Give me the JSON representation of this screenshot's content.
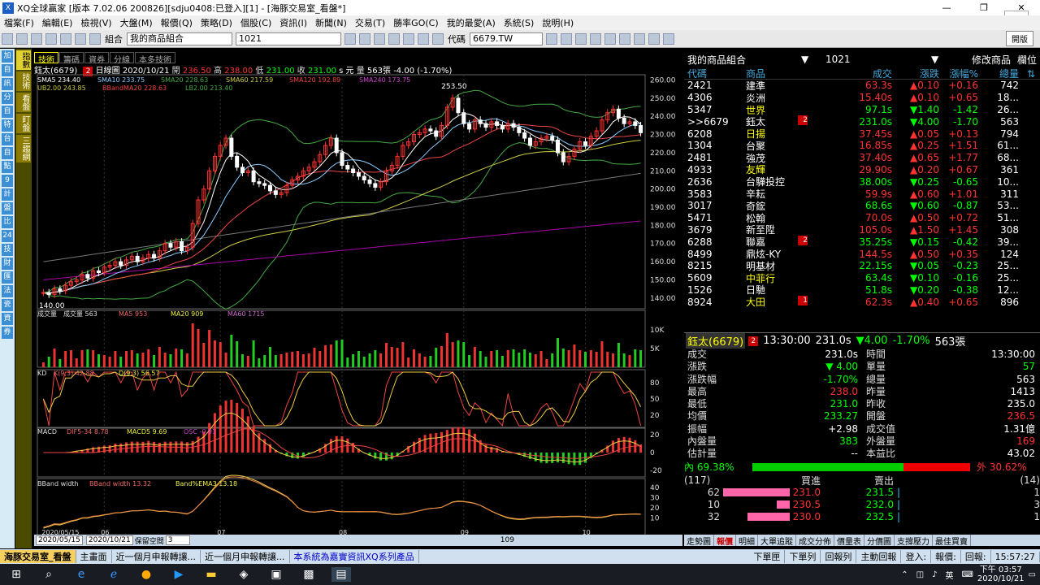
{
  "window": {
    "title": "XQ全球贏家 [版本 7.02.06 200826][sdju0408:已登入][1] - [海豚交易室_看盤*]",
    "min": "—",
    "max": "❐",
    "close": "✕"
  },
  "menu": [
    "檔案(F)",
    "編輯(E)",
    "檢視(V)",
    "大盤(M)",
    "報價(Q)",
    "策略(D)",
    "個股(C)",
    "資訊(I)",
    "新聞(N)",
    "交易(T)",
    "勝率GO(C)",
    "我的最愛(A)",
    "系統(S)",
    "說明(H)"
  ],
  "toolbar": {
    "group_label": "組合",
    "group_value": "我的商品組合",
    "list_value": "1021",
    "code_label": "代碼",
    "code_value": "6679.TW",
    "right_button": "開版"
  },
  "left_sidebar": [
    "加",
    "自",
    "訊",
    "分",
    "自",
    "特",
    "台",
    "自",
    "點",
    "9",
    "計",
    "盤",
    "比",
    "24",
    "技",
    "財",
    "匯",
    "法",
    "瓷",
    "資",
    "券"
  ],
  "vertical_tabs": [
    {
      "label": "指數",
      "active": true
    },
    {
      "label": "技術",
      "active": false
    },
    {
      "label": "看盤",
      "active": false
    },
    {
      "label": "盯盤",
      "active": false
    },
    {
      "label": "三趨網",
      "active": false
    }
  ],
  "chart_tabs": [
    {
      "label": "技術",
      "active": true
    },
    {
      "label": "籌碼",
      "active": false
    },
    {
      "label": "資券",
      "active": false
    },
    {
      "label": "分線",
      "active": false
    },
    {
      "label": "本多技術",
      "active": false
    }
  ],
  "stock_info": {
    "name": "鈺太(6679)",
    "badge": "2",
    "period": "日線圖",
    "date": "2020/10/21",
    "open_l": "開",
    "open": "236.50",
    "high_l": "高",
    "high": "238.00",
    "low_l": "低",
    "low": "231.00",
    "close_l": "收",
    "close": "231.00",
    "unit": "s 元",
    "vol_l": "量",
    "vol": "563張",
    "chg": "-4.00 (-1.70%)"
  },
  "chart_data": {
    "type": "line",
    "price": {
      "dates": [
        "05/15",
        "05/18",
        "05/19",
        "05/20",
        "05/21",
        "05/22",
        "05/25",
        "05/26",
        "05/27",
        "05/28",
        "05/29",
        "06/01",
        "06/02",
        "06/03",
        "06/04",
        "06/05",
        "06/08",
        "06/09",
        "06/10",
        "06/11",
        "06/12",
        "06/15",
        "06/16",
        "06/17",
        "06/18",
        "06/19",
        "06/22",
        "06/23",
        "06/24",
        "06/29",
        "06/30",
        "07/01",
        "07/02",
        "07/03",
        "07/06",
        "07/07",
        "07/08",
        "07/09",
        "07/10",
        "07/13",
        "07/14",
        "07/15",
        "07/16",
        "07/17",
        "07/20",
        "07/21",
        "07/22",
        "07/23",
        "07/24",
        "07/27",
        "07/28",
        "07/29",
        "07/30",
        "07/31",
        "08/03",
        "08/04",
        "08/05",
        "08/06",
        "08/07",
        "08/10",
        "08/11",
        "08/12",
        "08/13",
        "08/14",
        "08/17",
        "08/18",
        "08/19",
        "08/20",
        "08/21",
        "08/24",
        "08/25",
        "08/26",
        "08/27",
        "08/28",
        "08/31",
        "09/01",
        "09/02",
        "09/03",
        "09/04",
        "09/07",
        "09/08",
        "09/09",
        "09/10",
        "09/11",
        "09/14",
        "09/15",
        "09/16",
        "09/17",
        "09/18",
        "09/21",
        "09/22",
        "09/23",
        "09/24",
        "09/25",
        "09/28",
        "09/29",
        "09/30",
        "10/05",
        "10/06",
        "10/07",
        "10/08",
        "10/12",
        "10/13",
        "10/14",
        "10/15",
        "10/16",
        "10/19",
        "10/20",
        "10/21"
      ],
      "close": [
        143,
        142,
        145,
        144,
        147,
        149,
        150,
        153,
        151,
        155,
        154,
        157,
        158,
        160,
        158,
        161,
        163,
        160,
        162,
        164,
        162,
        166,
        170,
        168,
        171,
        166,
        168,
        181,
        194,
        200,
        210,
        218,
        224,
        228,
        218,
        212,
        209,
        210,
        204,
        203,
        202,
        199,
        197,
        198,
        202,
        205,
        207,
        210,
        212,
        215,
        219,
        224,
        228,
        220,
        213,
        211,
        209,
        207,
        205,
        203,
        201,
        204,
        210,
        213,
        218,
        224,
        226,
        230,
        231,
        233,
        232,
        229,
        235,
        245,
        250,
        242,
        236,
        233,
        238,
        236,
        234,
        237,
        235,
        233,
        236,
        234,
        231,
        228,
        224,
        226,
        228,
        229,
        227,
        220,
        215,
        218,
        222,
        226,
        224,
        229,
        232,
        238,
        242,
        244,
        239,
        236,
        237,
        235,
        231
      ],
      "ma5_label": "SMA5 234.40",
      "ma10_label": "SMA10 233.75",
      "ma20_label": "SMA20 228.63",
      "ma60_label": "SMA60 217.59",
      "ma120_label": "SMA120 192.89",
      "ma240_label": "SMA240 173.75",
      "ub_label": "UB2.00 243.85",
      "mid_label": "BBandMA20 228.63",
      "lb_label": "LB2.00 213.40",
      "ylim": [
        135,
        262
      ],
      "yticks": [
        260,
        250,
        240,
        230,
        220,
        210,
        200,
        190,
        180,
        170,
        160,
        150,
        140
      ],
      "max_label": "253.50",
      "min_label": "140.00"
    },
    "volume": {
      "title": "成交量",
      "cur": "成交量 563",
      "ma5": "MA5 953",
      "ma20": "MA20 909",
      "ma60": "MA60 1715",
      "yticks": [
        "10K",
        "5K"
      ]
    },
    "kd": {
      "title": "KD",
      "k": "K(9,3) 42.88",
      "d": "D(9,3) 56.57",
      "yticks": [
        80,
        50,
        20
      ]
    },
    "macd": {
      "title": "MACD",
      "dif": "DIF5-34 8.78",
      "macd": "MACD5 9.69",
      "osc": "OSC -0.91",
      "yticks": [
        20,
        0,
        -20
      ]
    },
    "bbw": {
      "title": "BBand width",
      "bw": "BBand width 13.32",
      "ema": "Band%EMA3 13.18",
      "yticks": [
        40,
        30,
        20,
        10
      ]
    },
    "xticks": [
      "2020/05/15",
      "06",
      "07",
      "08",
      "09",
      "10"
    ]
  },
  "chart_bottom": {
    "from": "2020/05/15",
    "to": "2020/10/21",
    "label": "保留空間",
    "space": "3",
    "count": "109"
  },
  "watchlist": {
    "title": "我的商品組合",
    "list": "1021",
    "edit": "修改商品",
    "col": "欄位",
    "headers": [
      "代碼",
      "商品",
      "成交",
      "漲跌",
      "漲幅%",
      "總量"
    ],
    "rows": [
      {
        "code": "2421",
        "name": "建準",
        "price": "63.3s",
        "chg": "▲0.10",
        "pct": "+0.16",
        "vol": "742",
        "nc": "#fff",
        "badge": ""
      },
      {
        "code": "4306",
        "name": "炎洲",
        "price": "15.40s",
        "chg": "▲0.10",
        "pct": "+0.65",
        "vol": "18...",
        "nc": "#fff",
        "badge": ""
      },
      {
        "code": "5347",
        "name": "世界",
        "price": "97.1s",
        "chg": "▼1.40",
        "pct": "-1.42",
        "vol": "26...",
        "nc": "#ff0",
        "badge": ""
      },
      {
        "code": ">>6679",
        "name": "鈺太",
        "price": "231.0s",
        "chg": "▼4.00",
        "pct": "-1.70",
        "vol": "563",
        "nc": "#fff",
        "badge": "2"
      },
      {
        "code": "6208",
        "name": "日揚",
        "price": "37.45s",
        "chg": "▲0.05",
        "pct": "+0.13",
        "vol": "794",
        "nc": "#ff0",
        "badge": ""
      },
      {
        "code": "1304",
        "name": "台聚",
        "price": "16.85s",
        "chg": "▲0.25",
        "pct": "+1.51",
        "vol": "61...",
        "nc": "#fff",
        "badge": ""
      },
      {
        "code": "2481",
        "name": "強茂",
        "price": "37.40s",
        "chg": "▲0.65",
        "pct": "+1.77",
        "vol": "68...",
        "nc": "#fff",
        "badge": ""
      },
      {
        "code": "4933",
        "name": "友輝",
        "price": "29.90s",
        "chg": "▲0.20",
        "pct": "+0.67",
        "vol": "361",
        "nc": "#ff0",
        "badge": ""
      },
      {
        "code": "2636",
        "name": "台驊投控",
        "price": "38.00s",
        "chg": "▼0.25",
        "pct": "-0.65",
        "vol": "10...",
        "nc": "#fff",
        "badge": ""
      },
      {
        "code": "3583",
        "name": "辛耘",
        "price": "59.9s",
        "chg": "▲0.60",
        "pct": "+1.01",
        "vol": "311",
        "nc": "#fff",
        "badge": ""
      },
      {
        "code": "3017",
        "name": "奇鋐",
        "price": "68.6s",
        "chg": "▼0.60",
        "pct": "-0.87",
        "vol": "53...",
        "nc": "#fff",
        "badge": ""
      },
      {
        "code": "5471",
        "name": "松翰",
        "price": "70.0s",
        "chg": "▲0.50",
        "pct": "+0.72",
        "vol": "51...",
        "nc": "#fff",
        "badge": ""
      },
      {
        "code": "3679",
        "name": "新至陞",
        "price": "105.0s",
        "chg": "▲1.50",
        "pct": "+1.45",
        "vol": "308",
        "nc": "#fff",
        "badge": ""
      },
      {
        "code": "6288",
        "name": "聯嘉",
        "price": "35.25s",
        "chg": "▼0.15",
        "pct": "-0.42",
        "vol": "39...",
        "nc": "#fff",
        "badge": "2"
      },
      {
        "code": "8499",
        "name": "鼎炫-KY",
        "price": "144.5s",
        "chg": "▲0.50",
        "pct": "+0.35",
        "vol": "124",
        "nc": "#fff",
        "badge": ""
      },
      {
        "code": "8215",
        "name": "明基材",
        "price": "22.15s",
        "chg": "▼0.05",
        "pct": "-0.23",
        "vol": "25...",
        "nc": "#fff",
        "badge": ""
      },
      {
        "code": "5609",
        "name": "中菲行",
        "price": "63.4s",
        "chg": "▼0.10",
        "pct": "-0.16",
        "vol": "25...",
        "nc": "#ff0",
        "badge": ""
      },
      {
        "code": "1526",
        "name": "日馳",
        "price": "51.8s",
        "chg": "▼0.20",
        "pct": "-0.38",
        "vol": "12...",
        "nc": "#fff",
        "badge": ""
      },
      {
        "code": "8924",
        "name": "大田",
        "price": "62.3s",
        "chg": "▲0.40",
        "pct": "+0.65",
        "vol": "896",
        "nc": "#ff0",
        "badge": "1"
      }
    ]
  },
  "detail": {
    "name": "鈺太(6679)",
    "badge": "2",
    "time": "13:30:00",
    "price": "231.0s",
    "chg": "▼4.00",
    "pct": "-1.70%",
    "vol": "563張",
    "cells": [
      [
        "成交",
        "231.0s",
        "#fff",
        "時間",
        "13:30:00",
        "#fff"
      ],
      [
        "漲跌",
        "▼ 4.00",
        "#0f0",
        "單量",
        "57",
        "#0f0"
      ],
      [
        "漲跌幅",
        "-1.70%",
        "#0f0",
        "總量",
        "563",
        "#fff"
      ],
      [
        "最高",
        "238.0",
        "#f33",
        "昨量",
        "1413",
        "#fff"
      ],
      [
        "最低",
        "231.0",
        "#0f0",
        "昨收",
        "235.0",
        "#fff"
      ],
      [
        "均價",
        "233.27",
        "#0f0",
        "開盤",
        "236.5",
        "#f33"
      ],
      [
        "振幅",
        "+2.98",
        "#fff",
        "成交值",
        "1.31億",
        "#fff"
      ],
      [
        "內盤量",
        "383",
        "#0f0",
        "外盤量",
        "169",
        "#f33"
      ],
      [
        "估計量",
        "--",
        "#fff",
        "本益比",
        "43.02",
        "#fff"
      ]
    ],
    "in_label": "內 69.38%",
    "in_ratio": 0.6938,
    "out_label": "外 30.62%",
    "ob_head_l": "(117)",
    "ob_bid": "買進",
    "ob_ask": "賣出",
    "ob_head_r": "(14)",
    "ob": [
      {
        "bq": "62",
        "bp": "231.0",
        "ap": "231.5",
        "aq": "1",
        "bfrac": 1.0
      },
      {
        "bq": "10",
        "bp": "230.5",
        "ap": "232.0",
        "aq": "3",
        "bfrac": 0.16
      },
      {
        "bq": "32",
        "bp": "230.0",
        "ap": "232.5",
        "aq": "1",
        "bfrac": 0.52
      }
    ]
  },
  "right_tabs": [
    "走勢圖",
    "報價",
    "明細",
    "大單追蹤",
    "成交分佈",
    "價量表",
    "分價圖",
    "支撐壓力",
    "最佳買賣"
  ],
  "status": {
    "tabs": [
      "海豚交易室_看盤",
      "主畫面",
      "近一個月申報轉讓...",
      "近一個月申報轉讓...",
      "本系統為嘉實資訊XQ系列產品"
    ],
    "right": [
      "下單匣",
      "下單列",
      "回報列",
      "主動回報",
      "登入:",
      "報價:",
      "回報:",
      "15:57:27"
    ]
  },
  "taskbar": {
    "ime": "英",
    "time": "下午 03:57",
    "date": "2020/10/21"
  }
}
